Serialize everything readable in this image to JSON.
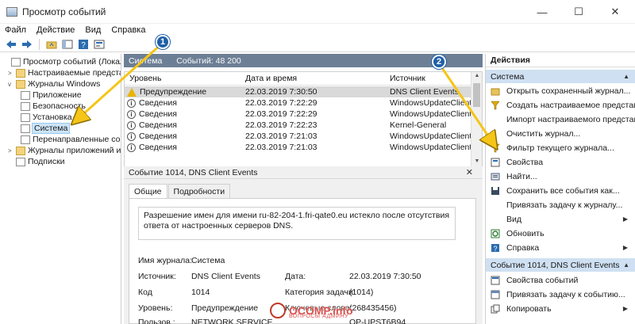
{
  "window": {
    "title": "Просмотр событий",
    "controls": {
      "minimize": "—",
      "maximize": "☐",
      "close": "✕"
    }
  },
  "menu": [
    "Файл",
    "Действие",
    "Вид",
    "Справка"
  ],
  "toolbar": [
    "back-arrow-icon",
    "forward-arrow-icon",
    "up-folder-icon",
    "show-hide-tree-icon",
    "help-icon",
    "properties-icon"
  ],
  "tree": {
    "root": "Просмотр событий (Локальный)",
    "custom_views": "Настраиваемые представле...",
    "windows_logs": "Журналы Windows",
    "app_log": "Приложение",
    "security_log": "Безопасность",
    "setup_log": "Установка",
    "system_log": "Система",
    "forwarded": "Перенаправленные собы",
    "apps_services": "Журналы приложений и слу",
    "subscriptions": "Подписки"
  },
  "center": {
    "log_name": "Система",
    "events_count": "Событий: 48 200",
    "columns": [
      "Уровень",
      "Дата и время",
      "Источник"
    ],
    "rows": [
      {
        "level": "Предупреждение",
        "type": "warning",
        "date": "22.03.2019 7:30:50",
        "source": "DNS Client Events"
      },
      {
        "level": "Сведения",
        "type": "info",
        "date": "22.03.2019 7:22:29",
        "source": "WindowsUpdateClient"
      },
      {
        "level": "Сведения",
        "type": "info",
        "date": "22.03.2019 7:22:29",
        "source": "WindowsUpdateClient"
      },
      {
        "level": "Сведения",
        "type": "info",
        "date": "22.03.2019 7:22:23",
        "source": "Kernel-General"
      },
      {
        "level": "Сведения",
        "type": "info",
        "date": "22.03.2019 7:21:03",
        "source": "WindowsUpdateClient"
      },
      {
        "level": "Сведения",
        "type": "info",
        "date": "22.03.2019 7:21:03",
        "source": "WindowsUpdateClient"
      }
    ],
    "event_header": "Событие 1014, DNS Client Events",
    "tabs": [
      "Общие",
      "Подробности"
    ],
    "description": "Разрешение имен для имени ru-82-204-1.fri-qate0.eu истекло после отсутствия ответа от настроенных серверов DNS.",
    "details": {
      "log_label": "Имя журнала:",
      "log_value": "Система",
      "source_label": "Источник:",
      "source_value": "DNS Client Events",
      "code_label": "Код",
      "code_value": "1014",
      "level_label": "Уровень:",
      "level_value": "Предупреждение",
      "user_label": "Пользов.:",
      "user_value": "NETWORK SERVICE",
      "date_label": "Дата:",
      "date_value": "22.03.2019 7:30:50",
      "task_label": "Категория задачи:",
      "task_value": "(1014)",
      "keywords_label": "Ключевые слова:",
      "keywords_value": "(268435456)",
      "computer_value": "OP-UPST6B94"
    }
  },
  "actions": {
    "header": "Действия",
    "section1": "Система",
    "items1": [
      {
        "label": "Открыть сохраненный журнал...",
        "icon": "open-log-icon"
      },
      {
        "label": "Создать настраиваемое представле...",
        "icon": "filter-icon"
      },
      {
        "label": "Импорт настраиваемого представле...",
        "icon": "none"
      },
      {
        "label": "Очистить журнал...",
        "icon": "none"
      },
      {
        "label": "Фильтр текущего журнала...",
        "icon": "filter-icon"
      },
      {
        "label": "Свойства",
        "icon": "properties-icon"
      },
      {
        "label": "Найти...",
        "icon": "find-icon"
      },
      {
        "label": "Сохранить все события как...",
        "icon": "save-icon"
      },
      {
        "label": "Привязать задачу к журналу...",
        "icon": "none"
      },
      {
        "label": "Вид",
        "icon": "none",
        "submenu": true
      },
      {
        "label": "Обновить",
        "icon": "refresh-icon"
      },
      {
        "label": "Справка",
        "icon": "help-icon",
        "submenu": true
      }
    ],
    "section2": "Событие 1014, DNS Client Events",
    "items2": [
      {
        "label": "Свойства событий",
        "icon": "event-properties-icon"
      },
      {
        "label": "Привязать задачу к событию...",
        "icon": "attach-task-icon"
      },
      {
        "label": "Копировать",
        "icon": "copy-icon",
        "submenu": true
      }
    ]
  },
  "annotations": {
    "badge1": "1",
    "badge2": "2",
    "arrow_color": "#f5c518"
  },
  "watermark": {
    "text": "OCOMP.info",
    "sub": "ВОПРОСЫ АДМИНУ"
  },
  "colors": {
    "header_bg": "#6d7f95",
    "section_bg": "#cfe0f2",
    "selection": "#cce4f7"
  }
}
